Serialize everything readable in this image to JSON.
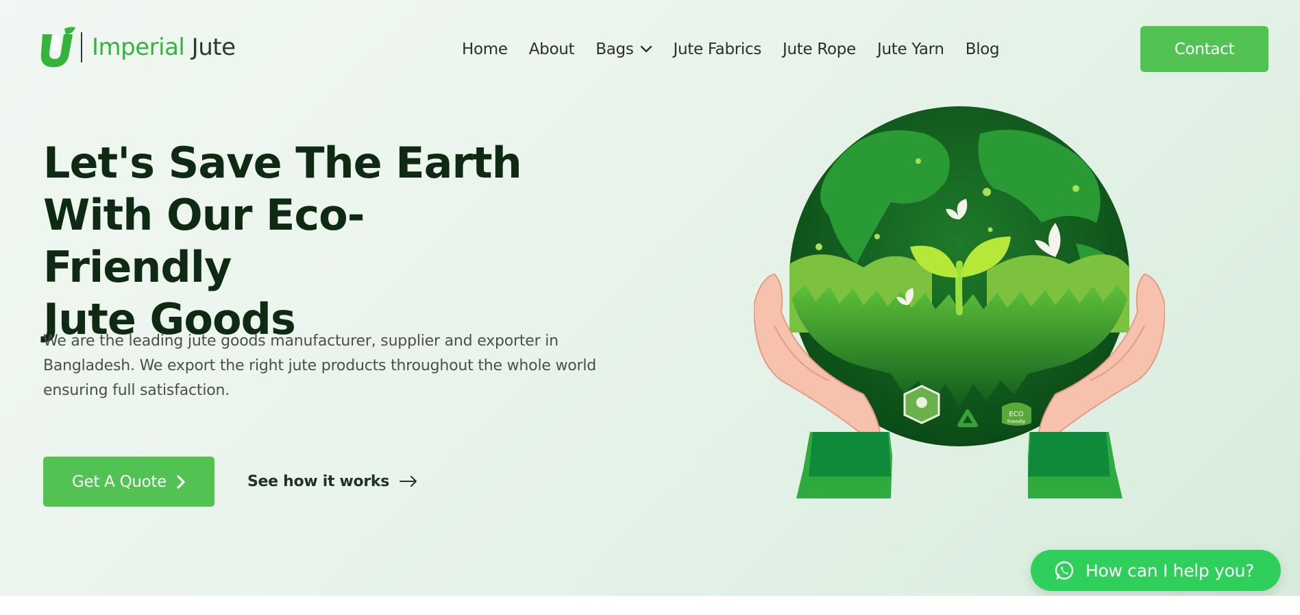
{
  "brand": {
    "name_part1": "Imperial",
    "name_part2": "Jute",
    "accent_color": "#52c253",
    "logo_icon": "ij-leaf-logo-icon"
  },
  "nav": {
    "items": [
      {
        "label": "Home"
      },
      {
        "label": "About"
      },
      {
        "label": "Bags",
        "has_dropdown": true
      },
      {
        "label": "Jute Fabrics"
      },
      {
        "label": "Jute Rope"
      },
      {
        "label": "Jute Yarn"
      },
      {
        "label": "Blog"
      }
    ],
    "contact_label": "Contact"
  },
  "hero": {
    "headline_line1": "Let's Save The Earth",
    "headline_line2": "With Our Eco-Friendly",
    "headline_line3": "Jute Goods",
    "description": "We are the leading jute goods manufacturer, supplier and exporter in Bangladesh. We export the right jute products throughout the whole world ensuring full satisfaction.",
    "primary_cta": "Get A Quote",
    "secondary_cta": "See how it works",
    "badge_left": "",
    "badge_right_line1": "ECO",
    "badge_right_line2": "friendly"
  },
  "chat_widget": {
    "label": "How can I help you?",
    "icon": "whatsapp-icon",
    "color": "#2fcf5c"
  }
}
